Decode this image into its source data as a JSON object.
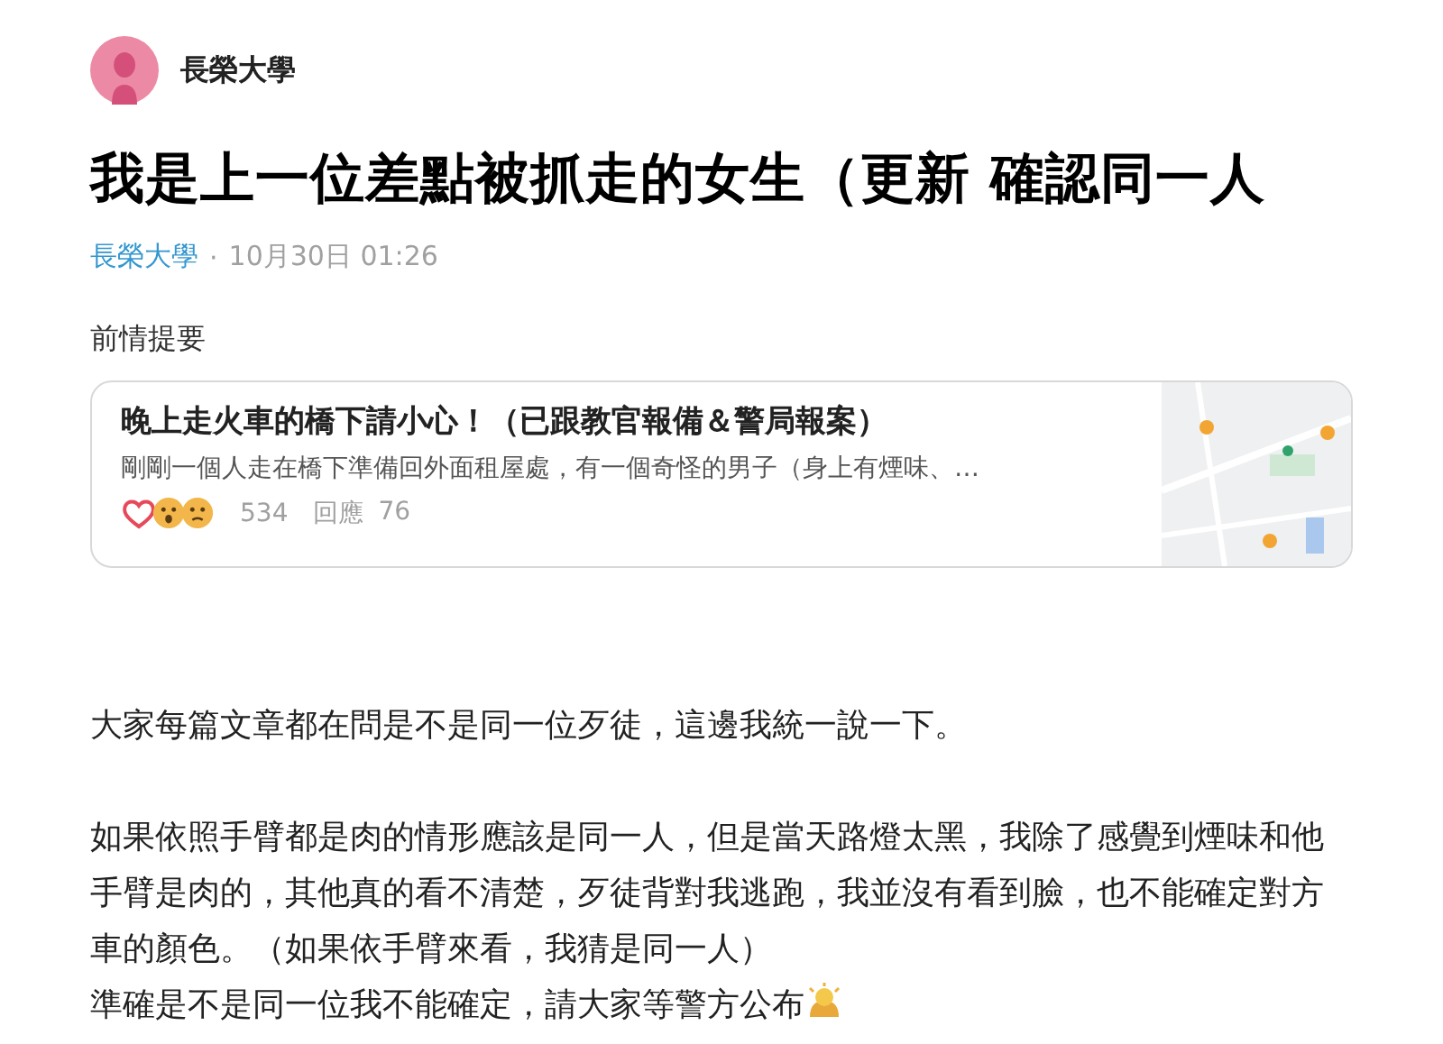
{
  "author": {
    "name": "長榮大學"
  },
  "post": {
    "title": "我是上一位差點被抓走的女生（更新 確認同一人",
    "school": "長榮大學",
    "separator": "·",
    "time": "10月30日 01:26"
  },
  "previous": {
    "label": "前情提要",
    "card": {
      "title": "晚上走火車的橋下請小心！（已跟教官報備＆警局報案）",
      "excerpt": "剛剛一個人走在橋下準備回外面租屋處，有一個奇怪的男子（身上有煙味、…",
      "reaction_count": "534",
      "reply_label": "回應",
      "reply_count": "76"
    }
  },
  "body": [
    {
      "kind": "paragraph",
      "text": "大家每篇文章都在問是不是同一位歹徒，這邊我統一說一下。"
    },
    {
      "kind": "paragraph",
      "text": "如果依照手臂都是肉的情形應該是同一人，但是當天路燈太黑，我除了感覺到煙味和他手臂是肉的，其他真的看不清楚，歹徒背對我逃跑，我並沒有看到臉，也不能確定對方車的顏色。（如果依手臂來看，我猜是同一人）"
    },
    {
      "kind": "line",
      "text": "準確是不是同一位我不能確定，請大家等警方公布",
      "emoji": true
    }
  ]
}
